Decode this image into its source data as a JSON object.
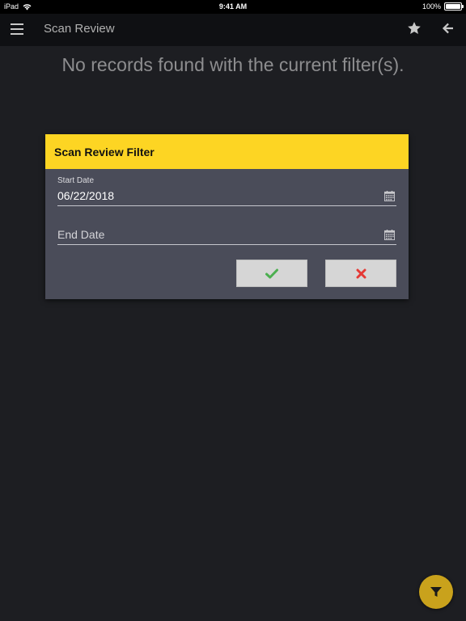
{
  "status_bar": {
    "device": "iPad",
    "time": "9:41 AM",
    "battery": "100%"
  },
  "app_bar": {
    "title": "Scan Review",
    "menu_icon": "hamburger-menu-icon",
    "favorite_icon": "star-icon",
    "back_icon": "arrow-left-icon"
  },
  "main": {
    "empty_message": "No records found with the current filter(s)."
  },
  "filter_dialog": {
    "title": "Scan Review Filter",
    "start_date": {
      "label": "Start Date",
      "value": "06/22/2018"
    },
    "end_date": {
      "placeholder": "End Date",
      "value": ""
    },
    "confirm_icon": "checkmark-icon",
    "cancel_icon": "close-x-icon"
  },
  "fab": {
    "icon": "filter-funnel-icon"
  },
  "colors": {
    "background": "#1d1e22",
    "app_bar": "#0f1013",
    "dialog_header": "#fdd523",
    "dialog_body": "#4a4c59",
    "button": "#d6d6d6",
    "confirm_green": "#4caf50",
    "cancel_red": "#e53935",
    "fab": "#c9a21c"
  }
}
